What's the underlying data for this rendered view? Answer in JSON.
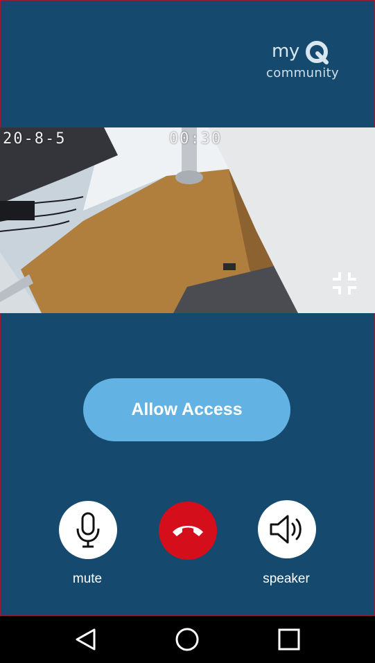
{
  "brand": {
    "logo_my": "my",
    "logo_community": "community"
  },
  "video": {
    "osd_date": "20-8-5",
    "osd_time": "00:30"
  },
  "actions": {
    "allow_access_label": "Allow Access"
  },
  "call_controls": {
    "mute_label": "mute",
    "speaker_label": "speaker"
  },
  "colors": {
    "background": "#15496d",
    "allow_button": "#62b3e4",
    "hangup": "#d40f1b"
  }
}
